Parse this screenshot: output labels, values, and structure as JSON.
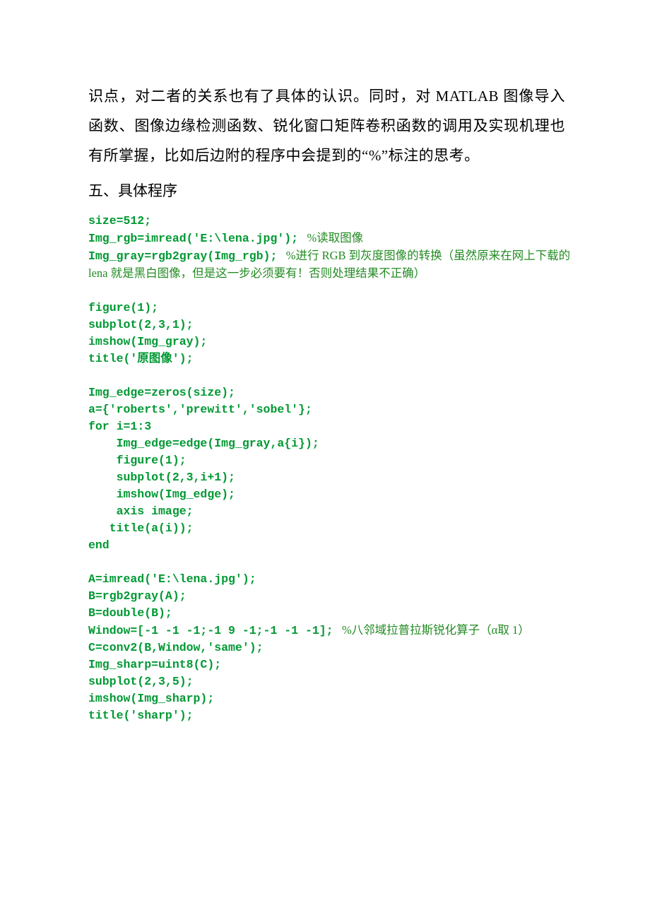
{
  "paragraph": {
    "p1_pre": "识点，对二者的关系也有了具体的认识。同时，对 ",
    "p1_roman": "MATLAB",
    "p1_post": " 图像导入函数、图像边缘检测函数、锐化窗口矩阵卷积函数的调用及实现机理也有所掌握，比如后边附的程序中会提到的“%”标注的思考。"
  },
  "section_title": "五、具体程序",
  "code": {
    "l1": "size=512;",
    "l2a": "Img_rgb=imread('E:\\lena.jpg');",
    "l2b": "   %读取图像",
    "l3a": "Img_gray=rgb2gray(Img_rgb);",
    "l3b": "   %进行 RGB 到灰度图像的转换（虽然原来在网上下载的",
    "l3c": "lena 就是黑白图像，但是这一步必须要有！否则处理结果不正确）",
    "l5": "figure(1);",
    "l6": "subplot(2,3,1);",
    "l7": "imshow(Img_gray);",
    "l8": "title('原图像');",
    "l10": "Img_edge=zeros(size);",
    "l11": "a={'roberts','prewitt','sobel'};",
    "l12a": "for",
    "l12b": " i=1:3",
    "l13": "    Img_edge=edge(Img_gray,a{i});",
    "l14": "    figure(1);",
    "l15": "    subplot(2,3,i+1);",
    "l16": "    imshow(Img_edge);",
    "l17": "    axis image;",
    "l18": "   title(a(i));",
    "l19": "end",
    "l21": "A=imread('E:\\lena.jpg');",
    "l22": "B=rgb2gray(A);",
    "l23": "B=double(B);",
    "l24a": "Window=[-1 -1 -1;-1 9 -1;-1 -1 -1];",
    "l24b": "   %八邻域拉普拉斯锐化算子（α取 1）",
    "l25": "C=conv2(B,Window,'same');",
    "l26": "Img_sharp=uint8(C);",
    "l27": "subplot(2,3,5);",
    "l28": "imshow(Img_sharp);",
    "l29": "title('sharp');"
  }
}
